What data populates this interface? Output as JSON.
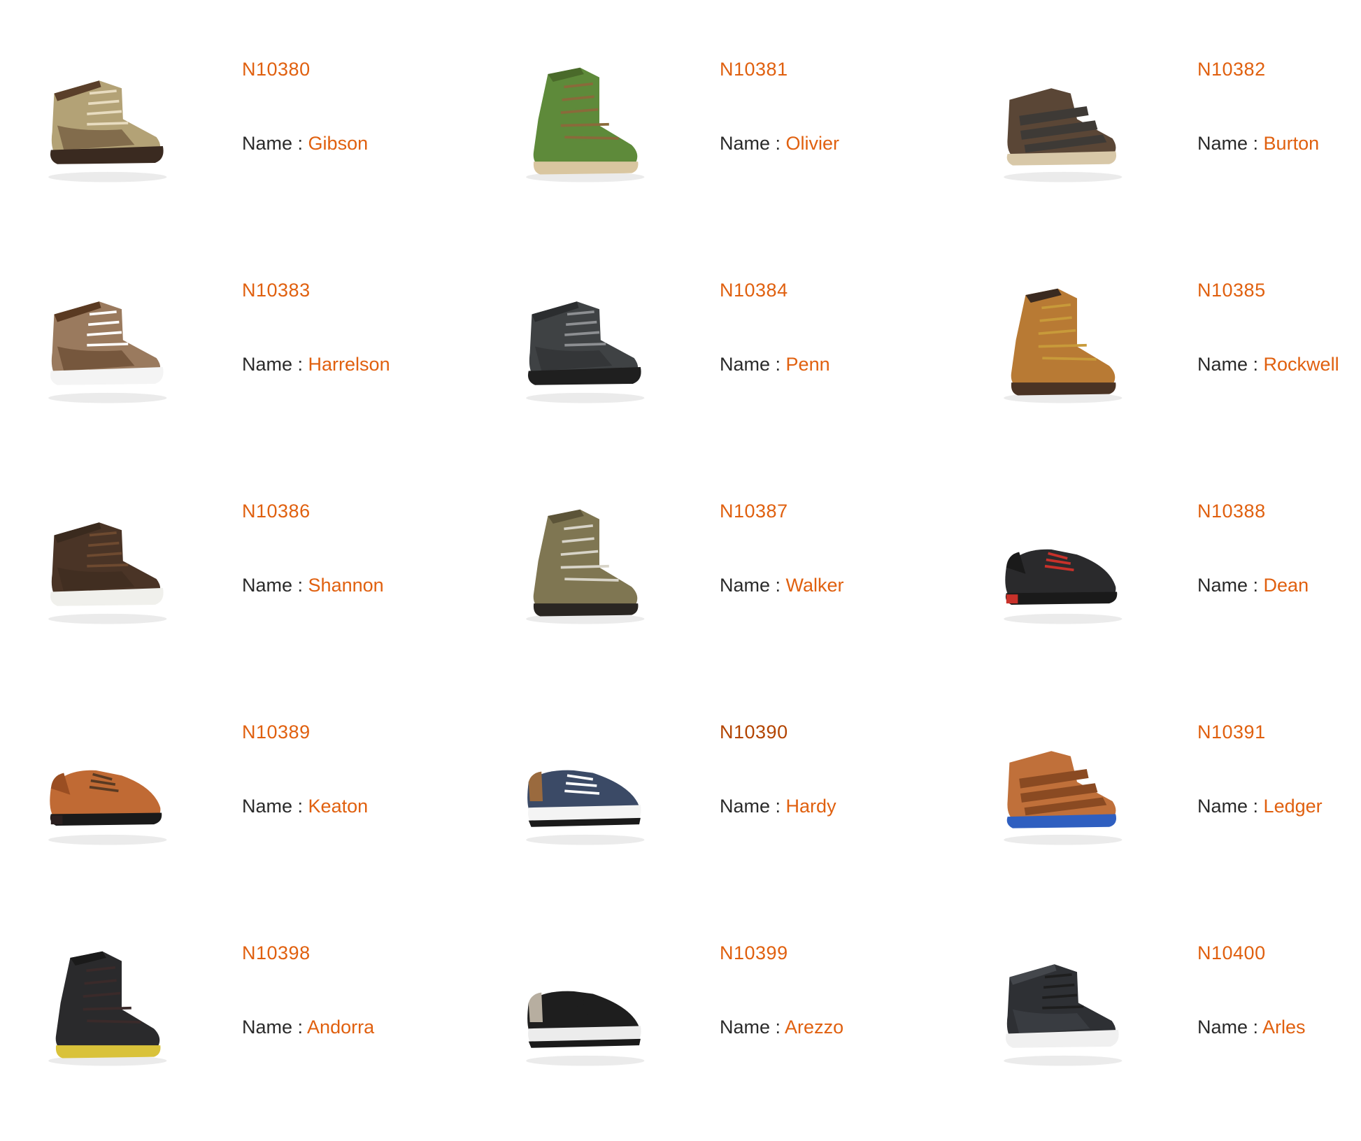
{
  "label_prefix": "Name :",
  "accent_color": "#e0600f",
  "products": [
    {
      "code": "N10380",
      "name": "Gibson",
      "icon": "tan-suede-high-top-sneaker-icon",
      "upper": "#b3a276",
      "trim": "#5a3f2a",
      "sole": "#3a2a20",
      "lace": "#e8dcc0",
      "style": "hightop"
    },
    {
      "code": "N10381",
      "name": "Olivier",
      "icon": "green-suede-chukka-boot-icon",
      "upper": "#5e8a3a",
      "trim": "#4a6a2a",
      "sole": "#d9c6a0",
      "lace": "#8a6a3a",
      "style": "boot"
    },
    {
      "code": "N10382",
      "name": "Burton",
      "icon": "brown-strap-sneaker-icon",
      "upper": "#5a4636",
      "trim": "#3e3a36",
      "sole": "#d8c8a8",
      "lace": "#2e2a26",
      "style": "strap"
    },
    {
      "code": "N10383",
      "name": "Harrelson",
      "icon": "taupe-lace-up-sneaker-icon",
      "upper": "#9a7a5e",
      "trim": "#5a3a22",
      "sole": "#f4f4f4",
      "lace": "#ffffff",
      "style": "hightop"
    },
    {
      "code": "N10384",
      "name": "Penn",
      "icon": "charcoal-high-top-sneaker-icon",
      "upper": "#3f4244",
      "trim": "#2b2d2f",
      "sole": "#1f1f1f",
      "lace": "#8d8f92",
      "style": "hightop"
    },
    {
      "code": "N10385",
      "name": "Rockwell",
      "icon": "tan-leather-hiking-boot-icon",
      "upper": "#b87a34",
      "trim": "#3a2a20",
      "sole": "#4a3324",
      "lace": "#c89a3a",
      "style": "boot"
    },
    {
      "code": "N10386",
      "name": "Shannon",
      "icon": "dark-brown-suede-sneaker-icon",
      "upper": "#4a3426",
      "trim": "#3a2a1e",
      "sole": "#f0f0ec",
      "lace": "#6e4a30",
      "style": "hightop"
    },
    {
      "code": "N10387",
      "name": "Walker",
      "icon": "olive-hiking-boot-icon",
      "upper": "#7f7652",
      "trim": "#5c5438",
      "sole": "#2a2622",
      "lace": "#d8d4c8",
      "style": "boot"
    },
    {
      "code": "N10388",
      "name": "Dean",
      "icon": "black-wingtip-oxford-icon",
      "upper": "#2a2a2c",
      "trim": "#1a1a1a",
      "sole": "#c8312a",
      "lace": "#c8312a",
      "style": "oxford"
    },
    {
      "code": "N10389",
      "name": "Keaton",
      "icon": "cognac-derby-shoe-icon",
      "upper": "#c06a34",
      "trim": "#9a4e22",
      "sole": "#2a2020",
      "lace": "#5a3a22",
      "style": "oxford"
    },
    {
      "code": "N10390",
      "name": "Hardy",
      "icon": "navy-leather-sneaker-icon",
      "upper": "#3b4a66",
      "trim": "#9a6a3e",
      "sole": "#f4f4f4",
      "lace": "#ffffff",
      "style": "lowtop"
    },
    {
      "code": "N10391",
      "name": "Ledger",
      "icon": "cognac-strap-sneaker-icon",
      "upper": "#c0703a",
      "trim": "#8a4a22",
      "sole": "#2f5fc0",
      "lace": "#5a3a22",
      "style": "strap"
    },
    {
      "code": "N10398",
      "name": "Andorra",
      "icon": "black-hiking-boot-icon",
      "upper": "#2a2a2c",
      "trim": "#1a1a1a",
      "sole": "#d9c23a",
      "lace": "#3a2a2a",
      "style": "boot"
    },
    {
      "code": "N10399",
      "name": "Arezzo",
      "icon": "snakeskin-runner-sneaker-icon",
      "upper": "#1e1e1e",
      "trim": "#b7aea0",
      "sole": "#ececec",
      "lace": "#1e1e1e",
      "style": "lowtop"
    },
    {
      "code": "N10400",
      "name": "Arles",
      "icon": "black-suede-high-top-sneaker-icon",
      "upper": "#2e3034",
      "trim": "#44474c",
      "sole": "#f0f0f0",
      "lace": "#1e1e1e",
      "style": "hightop"
    }
  ]
}
